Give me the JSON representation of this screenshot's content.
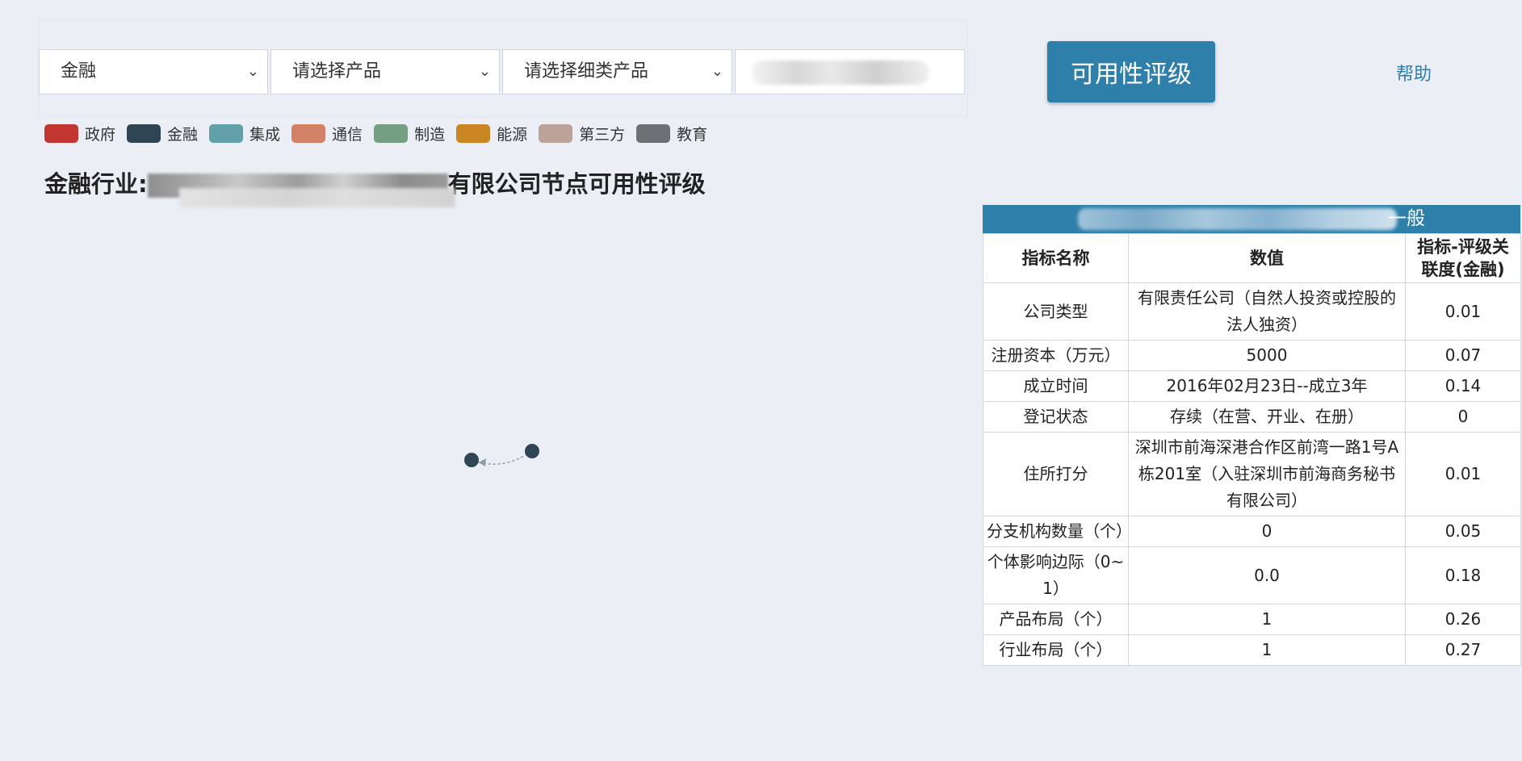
{
  "filters": {
    "industry": "金融",
    "product": "请选择产品",
    "sub_product": "请选择细类产品",
    "company_input": ""
  },
  "actions": {
    "rate_button": "可用性评级",
    "help_link": "帮助"
  },
  "legend": [
    {
      "label": "政府",
      "color": "#c23531"
    },
    {
      "label": "金融",
      "color": "#2f4554"
    },
    {
      "label": "集成",
      "color": "#61a0a8"
    },
    {
      "label": "通信",
      "color": "#d48265"
    },
    {
      "label": "制造",
      "color": "#749f83"
    },
    {
      "label": "能源",
      "color": "#ca8622"
    },
    {
      "label": "第三方",
      "color": "#bda29a"
    },
    {
      "label": "教育",
      "color": "#6e7074"
    }
  ],
  "title": {
    "prefix": "金融行业:",
    "suffix": "有限公司节点可用性评级"
  },
  "panel": {
    "rating": "一般",
    "headers": [
      "指标名称",
      "数值",
      "指标-评级关联度(金融)"
    ],
    "rows": [
      {
        "name": "公司类型",
        "value": "有限责任公司（自然人投资或控股的法人独资）",
        "relevance": "0.01"
      },
      {
        "name": "注册资本（万元）",
        "value": "5000",
        "relevance": "0.07"
      },
      {
        "name": "成立时间",
        "value": "2016年02月23日--成立3年",
        "relevance": "0.14"
      },
      {
        "name": "登记状态",
        "value": "存续（在营、开业、在册）",
        "relevance": "0"
      },
      {
        "name": "住所打分",
        "value": "深圳市前海深港合作区前湾一路1号A栋201室（入驻深圳市前海商务秘书有限公司）",
        "relevance": "0.01"
      },
      {
        "name": "分支机构数量（个）",
        "value": "0",
        "relevance": "0.05"
      },
      {
        "name": "个体影响边际（0~1）",
        "value": "0.0",
        "relevance": "0.18"
      },
      {
        "name": "产品布局（个）",
        "value": "1",
        "relevance": "0.26"
      },
      {
        "name": "行业布局（个）",
        "value": "1",
        "relevance": "0.27"
      }
    ]
  },
  "graph": {
    "node_color": "#2f4554",
    "edge_color": "#8a9aa6"
  }
}
